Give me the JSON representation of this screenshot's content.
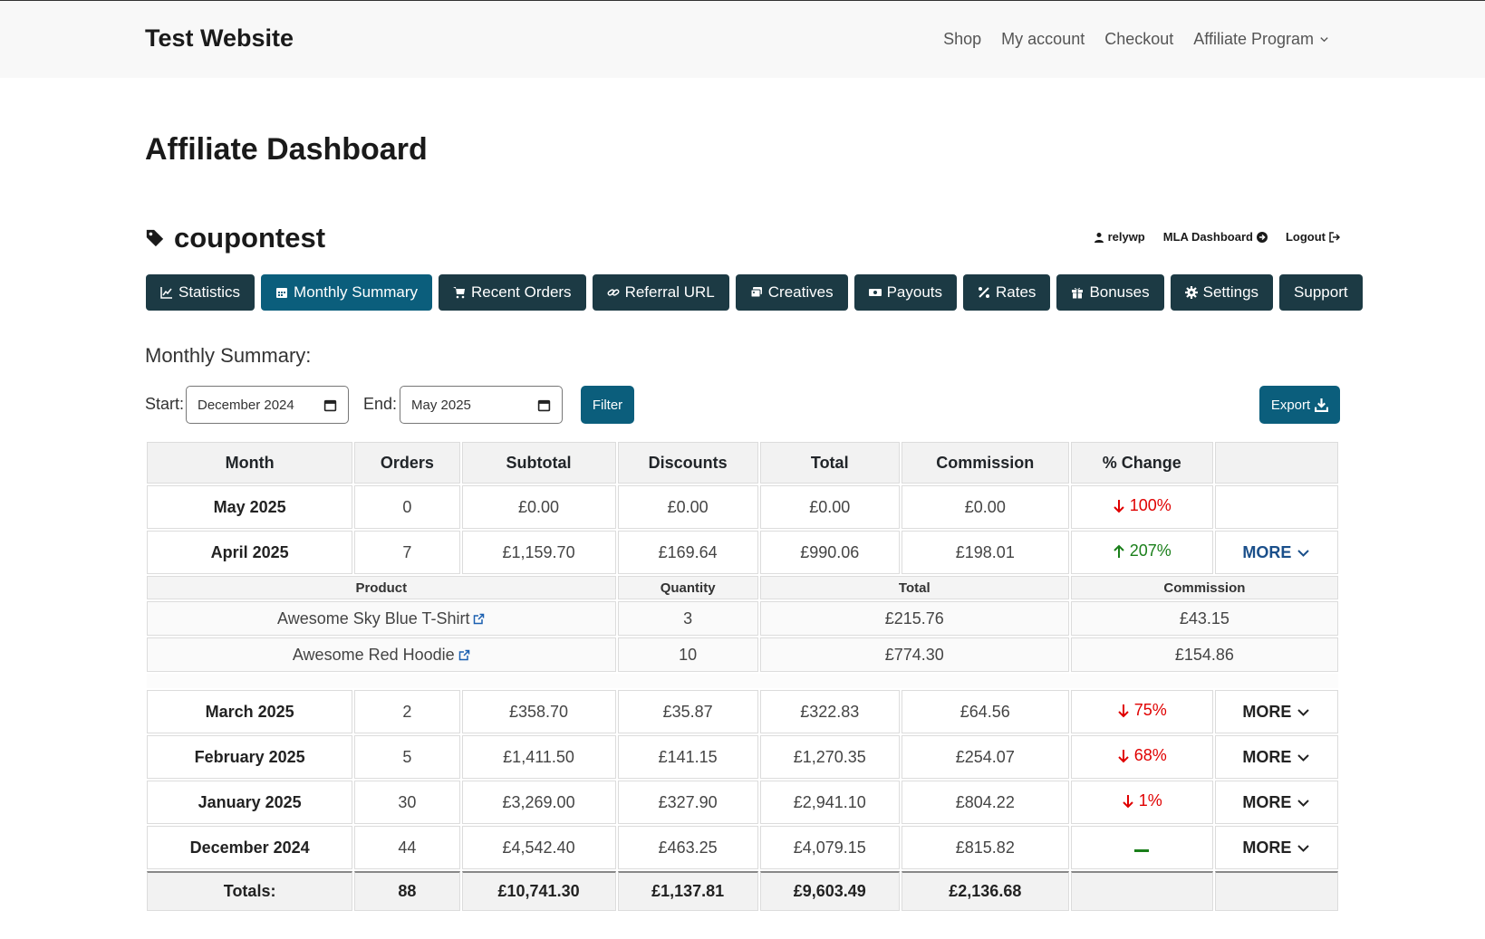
{
  "site": {
    "title": "Test Website",
    "nav": [
      {
        "label": "Shop"
      },
      {
        "label": "My account"
      },
      {
        "label": "Checkout"
      },
      {
        "label": "Affiliate Program"
      }
    ]
  },
  "page": {
    "title": "Affiliate Dashboard"
  },
  "affiliate": {
    "name": "coupontest",
    "user_links": [
      {
        "label": "relywp",
        "icon": "user-icon"
      },
      {
        "label": "MLA Dashboard",
        "icon": "arrow-circle-right-icon"
      },
      {
        "label": "Logout",
        "icon": "logout-icon"
      }
    ]
  },
  "tabs": [
    {
      "label": "Statistics",
      "icon": "chart-line-icon"
    },
    {
      "label": "Monthly Summary",
      "icon": "calendar-icon",
      "active": true
    },
    {
      "label": "Recent Orders",
      "icon": "cart-icon"
    },
    {
      "label": "Referral URL",
      "icon": "link-icon"
    },
    {
      "label": "Creatives",
      "icon": "images-icon"
    },
    {
      "label": "Payouts",
      "icon": "money-icon"
    },
    {
      "label": "Rates",
      "icon": "percent-icon"
    },
    {
      "label": "Bonuses",
      "icon": "gift-icon"
    },
    {
      "label": "Settings",
      "icon": "gear-icon"
    },
    {
      "label": "Support",
      "icon": ""
    }
  ],
  "summary": {
    "title": "Monthly Summary:",
    "start_label": "Start:",
    "start_value": "December 2024",
    "end_label": "End:",
    "end_value": "May 2025",
    "filter_label": "Filter",
    "export_label": "Export"
  },
  "table": {
    "headers": [
      "Month",
      "Orders",
      "Subtotal",
      "Discounts",
      "Total",
      "Commission",
      "% Change",
      ""
    ],
    "more_label": "MORE",
    "rows": [
      {
        "month": "May 2025",
        "orders": "0",
        "subtotal": "£0.00",
        "discounts": "£0.00",
        "total": "£0.00",
        "commission": "£0.00",
        "change": "100%",
        "direction": "down"
      },
      {
        "month": "April 2025",
        "orders": "7",
        "subtotal": "£1,159.70",
        "discounts": "£169.64",
        "total": "£990.06",
        "commission": "£198.01",
        "change": "207%",
        "direction": "up"
      },
      {
        "month": "March 2025",
        "orders": "2",
        "subtotal": "£358.70",
        "discounts": "£35.87",
        "total": "£322.83",
        "commission": "£64.56",
        "change": "75%",
        "direction": "down"
      },
      {
        "month": "February 2025",
        "orders": "5",
        "subtotal": "£1,411.50",
        "discounts": "£141.15",
        "total": "£1,270.35",
        "commission": "£254.07",
        "change": "68%",
        "direction": "down"
      },
      {
        "month": "January 2025",
        "orders": "30",
        "subtotal": "£3,269.00",
        "discounts": "£327.90",
        "total": "£2,941.10",
        "commission": "£804.22",
        "change": "1%",
        "direction": "down"
      },
      {
        "month": "December 2024",
        "orders": "44",
        "subtotal": "£4,542.40",
        "discounts": "£463.25",
        "total": "£4,079.15",
        "commission": "£815.82",
        "change": "",
        "direction": "none"
      }
    ],
    "details": {
      "headers": [
        "Product",
        "Quantity",
        "Total",
        "Commission"
      ],
      "rows": [
        {
          "product": "Awesome Sky Blue T-Shirt",
          "quantity": "3",
          "total": "£215.76",
          "commission": "£43.15"
        },
        {
          "product": "Awesome Red Hoodie",
          "quantity": "10",
          "total": "£774.30",
          "commission": "£154.86"
        }
      ]
    },
    "totals": {
      "label": "Totals:",
      "orders": "88",
      "subtotal": "£10,741.30",
      "discounts": "£1,137.81",
      "total": "£9,603.49",
      "commission": "£2,136.68"
    }
  }
}
